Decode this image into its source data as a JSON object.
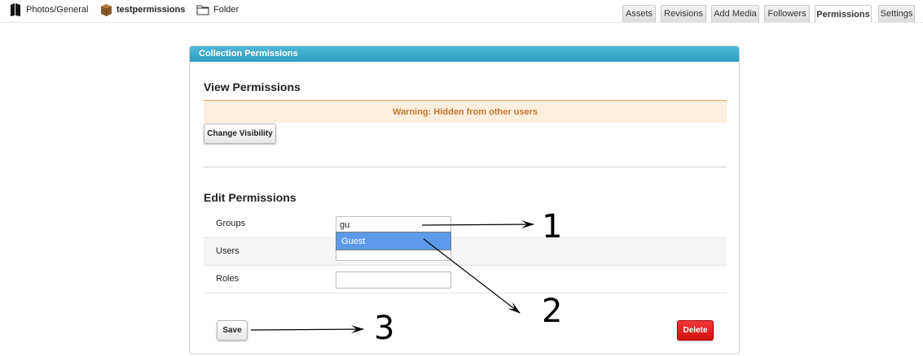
{
  "breadcrumbs": [
    {
      "label": "Photos/General",
      "icon": "book-icon"
    },
    {
      "label": "testpermissions",
      "icon": "package-icon"
    },
    {
      "label": "Folder",
      "icon": "folder-icon"
    }
  ],
  "tabs": [
    {
      "label": "Assets",
      "active": false
    },
    {
      "label": "Revisions",
      "active": false
    },
    {
      "label": "Add Media",
      "active": false
    },
    {
      "label": "Followers",
      "active": false
    },
    {
      "label": "Permissions",
      "active": true
    },
    {
      "label": "Settings",
      "active": false
    }
  ],
  "panel": {
    "title": "Collection Permissions",
    "view": {
      "title": "View Permissions",
      "warning": "Warning: Hidden from other users",
      "change_visibility_label": "Change Visibility"
    },
    "edit": {
      "title": "Edit Permissions",
      "rows": [
        {
          "label": "Groups",
          "value": "gu"
        },
        {
          "label": "Users",
          "value": ""
        },
        {
          "label": "Roles",
          "value": ""
        }
      ],
      "suggestion": "Guest"
    },
    "save_label": "Save",
    "delete_label": "Delete"
  },
  "annotations": [
    "1",
    "2",
    "3"
  ],
  "colors": {
    "header": "#2a9ec2",
    "warning_bg": "#fdeedd",
    "warning_text": "#c8772a",
    "delete": "#e01010",
    "suggestion": "#5b9bea"
  }
}
